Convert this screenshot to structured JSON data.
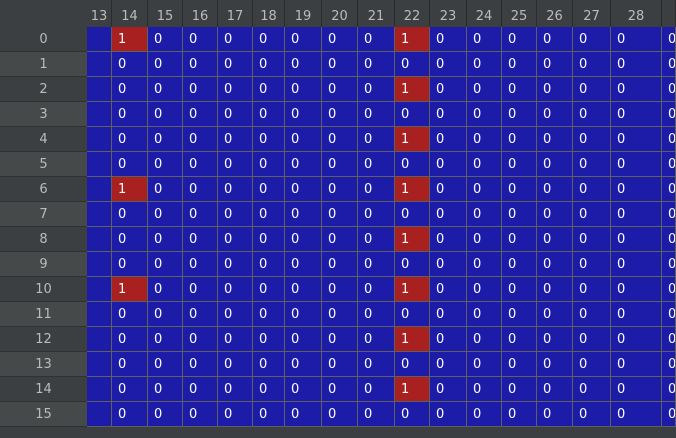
{
  "columns": [
    "13",
    "14",
    "15",
    "16",
    "17",
    "18",
    "19",
    "20",
    "21",
    "22",
    "23",
    "24",
    "25",
    "26",
    "27",
    "28",
    ""
  ],
  "rows": [
    "0",
    "1",
    "2",
    "3",
    "4",
    "5",
    "6",
    "7",
    "8",
    "9",
    "10",
    "11",
    "12",
    "13",
    "14",
    "15"
  ],
  "cells": [
    [
      "",
      "1",
      "0",
      "0",
      "0",
      "0",
      "0",
      "0",
      "0",
      "1",
      "0",
      "0",
      "0",
      "0",
      "0",
      "0",
      "0"
    ],
    [
      "",
      "0",
      "0",
      "0",
      "0",
      "0",
      "0",
      "0",
      "0",
      "0",
      "0",
      "0",
      "0",
      "0",
      "0",
      "0",
      "0"
    ],
    [
      "",
      "0",
      "0",
      "0",
      "0",
      "0",
      "0",
      "0",
      "0",
      "1",
      "0",
      "0",
      "0",
      "0",
      "0",
      "0",
      "0"
    ],
    [
      "",
      "0",
      "0",
      "0",
      "0",
      "0",
      "0",
      "0",
      "0",
      "0",
      "0",
      "0",
      "0",
      "0",
      "0",
      "0",
      "0"
    ],
    [
      "",
      "0",
      "0",
      "0",
      "0",
      "0",
      "0",
      "0",
      "0",
      "1",
      "0",
      "0",
      "0",
      "0",
      "0",
      "0",
      "0"
    ],
    [
      "",
      "0",
      "0",
      "0",
      "0",
      "0",
      "0",
      "0",
      "0",
      "0",
      "0",
      "0",
      "0",
      "0",
      "0",
      "0",
      "0"
    ],
    [
      "",
      "1",
      "0",
      "0",
      "0",
      "0",
      "0",
      "0",
      "0",
      "1",
      "0",
      "0",
      "0",
      "0",
      "0",
      "0",
      "0"
    ],
    [
      "",
      "0",
      "0",
      "0",
      "0",
      "0",
      "0",
      "0",
      "0",
      "0",
      "0",
      "0",
      "0",
      "0",
      "0",
      "0",
      "0"
    ],
    [
      "",
      "0",
      "0",
      "0",
      "0",
      "0",
      "0",
      "0",
      "0",
      "1",
      "0",
      "0",
      "0",
      "0",
      "0",
      "0",
      "0"
    ],
    [
      "",
      "0",
      "0",
      "0",
      "0",
      "0",
      "0",
      "0",
      "0",
      "0",
      "0",
      "0",
      "0",
      "0",
      "0",
      "0",
      "0"
    ],
    [
      "",
      "1",
      "0",
      "0",
      "0",
      "0",
      "0",
      "0",
      "0",
      "1",
      "0",
      "0",
      "0",
      "0",
      "0",
      "0",
      "0"
    ],
    [
      "",
      "0",
      "0",
      "0",
      "0",
      "0",
      "0",
      "0",
      "0",
      "0",
      "0",
      "0",
      "0",
      "0",
      "0",
      "0",
      "0"
    ],
    [
      "",
      "0",
      "0",
      "0",
      "0",
      "0",
      "0",
      "0",
      "0",
      "1",
      "0",
      "0",
      "0",
      "0",
      "0",
      "0",
      "0"
    ],
    [
      "",
      "0",
      "0",
      "0",
      "0",
      "0",
      "0",
      "0",
      "0",
      "0",
      "0",
      "0",
      "0",
      "0",
      "0",
      "0",
      "0"
    ],
    [
      "",
      "0",
      "0",
      "0",
      "0",
      "0",
      "0",
      "0",
      "0",
      "1",
      "0",
      "0",
      "0",
      "0",
      "0",
      "0",
      "0"
    ],
    [
      "",
      "0",
      "0",
      "0",
      "0",
      "0",
      "0",
      "0",
      "0",
      "0",
      "0",
      "0",
      "0",
      "0",
      "0",
      "0",
      "0"
    ]
  ],
  "colors": {
    "value_0": "#1c1ca8",
    "value_1": "#a8201f"
  }
}
